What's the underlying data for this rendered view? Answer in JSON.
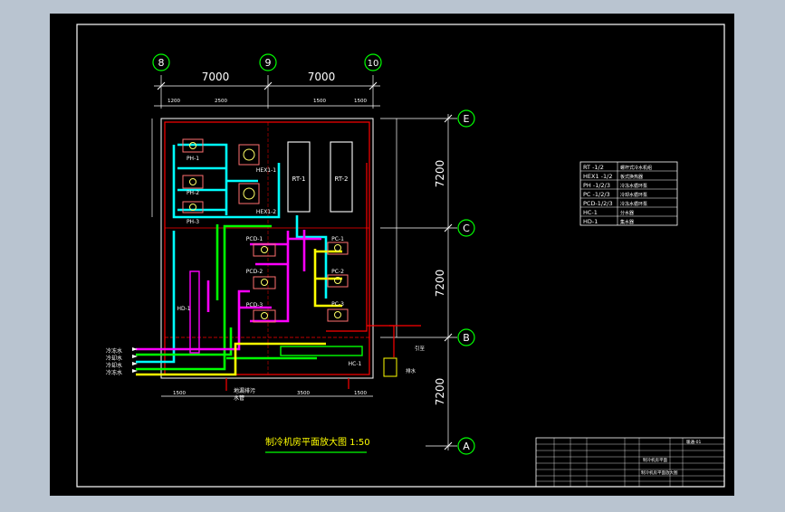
{
  "drawing": {
    "title": "制冷机房平面放大图  1:50",
    "axes_top": [
      "8",
      "9",
      "10"
    ],
    "axes_right": [
      "E",
      "C",
      "B",
      "A"
    ],
    "dims_top_main": [
      "7000",
      "7000"
    ],
    "dims_top_sub": [
      "1200",
      "2500",
      "1500",
      "1500"
    ],
    "dims_right_main": [
      "7200",
      "7200",
      "7200"
    ],
    "dims_bottom": [
      "1500",
      "3500",
      "1500"
    ],
    "equipment": {
      "rt1": "RT-1",
      "rt2": "RT-2",
      "ph1": "PH-1",
      "ph2": "PH-2",
      "ph3": "PH-3",
      "hex1": "HEX1-1",
      "hex2": "HEX1-2",
      "pcd1": "PCD-1",
      "pcd2": "PCD-2",
      "pcd3": "PCD-3",
      "pc1": "PC-1",
      "pc2": "PC-2",
      "pc3": "PC-3",
      "hd1": "HD-1",
      "hc1": "HC-1"
    },
    "pipe_labels": [
      "冷冻水",
      "冷却水",
      "冷却水",
      "冷冻水"
    ],
    "bottom_note": [
      "地漏排污",
      "水管"
    ],
    "right_note": "引至",
    "right_box_label": "排水",
    "colors": {
      "background": "#000000",
      "frame": "#ffffff",
      "wall": "#ff0000",
      "axis_circle": "#00ff00",
      "chilled": "#00ffff",
      "cooling": "#00ff00",
      "magenta": "#ff00ff",
      "yellow": "#ffff00"
    }
  },
  "legend": {
    "rows": [
      {
        "code": "RT -1/2",
        "desc": "螺杆式冷水机组"
      },
      {
        "code": "HEX1 -1/2",
        "desc": "板式换热器"
      },
      {
        "code": "PH -1/2/3",
        "desc": "冷冻水循环泵"
      },
      {
        "code": "PC -1/2/3",
        "desc": "冷却水循环泵"
      },
      {
        "code": "PCD-1/2/3",
        "desc": "冷冻水循环泵"
      },
      {
        "code": "HC-1",
        "desc": "分水器"
      },
      {
        "code": "HD-1",
        "desc": "集水器"
      }
    ]
  },
  "title_block": {
    "project": "制冷机房平面",
    "drawing_name": "制冷机房平面放大图",
    "sheet": "暖通-01"
  }
}
